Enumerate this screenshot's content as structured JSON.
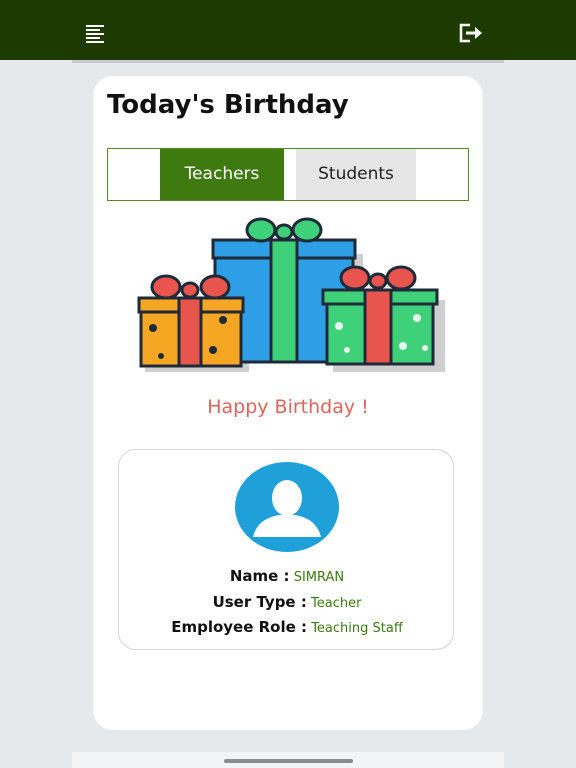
{
  "header": {
    "menu_icon": "menu-icon",
    "logout_icon": "logout-icon",
    "bg_color": "#1d3a03"
  },
  "page": {
    "title": "Today's Birthday"
  },
  "tabs": [
    {
      "label": "Teachers",
      "active": true
    },
    {
      "label": "Students",
      "active": false
    }
  ],
  "illustration": {
    "icon": "gift-boxes-icon"
  },
  "greeting": "Happy Birthday !",
  "profile": {
    "avatar_icon": "user-avatar-icon",
    "name_label": "Name :",
    "name_value": "SIMRAN",
    "user_type_label": "User Type :",
    "user_type_value": "Teacher",
    "role_label": "Employee Role :",
    "role_value": "Teaching Staff"
  },
  "colors": {
    "accent": "#3f7a10",
    "greeting": "#d9665a",
    "value_text": "#3b7a12"
  }
}
